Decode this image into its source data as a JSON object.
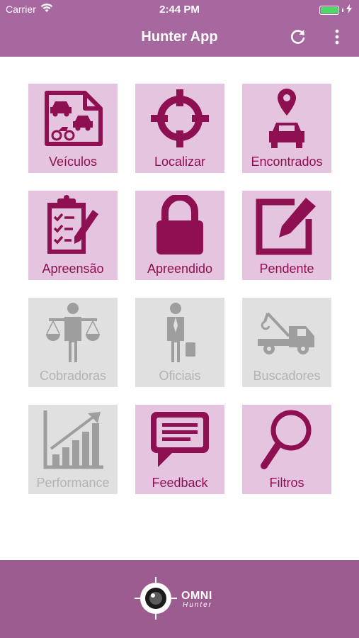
{
  "status_bar": {
    "carrier": "Carrier",
    "time": "2:44 PM",
    "battery_level": 1.0
  },
  "nav": {
    "title": "Hunter App",
    "refresh_icon": "refresh-icon",
    "menu_icon": "more-vertical-icon"
  },
  "colors": {
    "bar": "#a6689f",
    "footer": "#9c5c8f",
    "tile_active": "#e5c4df",
    "tile_disabled": "#e0e0e0",
    "icon_active": "#8e0f52",
    "icon_disabled": "#9e9e9e"
  },
  "tiles": [
    {
      "label": "Veículos",
      "icon": "vehicles-document-icon",
      "enabled": true
    },
    {
      "label": "Localizar",
      "icon": "crosshair-icon",
      "enabled": true
    },
    {
      "label": "Encontrados",
      "icon": "car-location-pin-icon",
      "enabled": true
    },
    {
      "label": "Apreensão",
      "icon": "clipboard-checklist-icon",
      "enabled": true
    },
    {
      "label": "Apreendido",
      "icon": "padlock-icon",
      "enabled": true
    },
    {
      "label": "Pendente",
      "icon": "edit-square-icon",
      "enabled": true
    },
    {
      "label": "Cobradoras",
      "icon": "person-scales-icon",
      "enabled": false
    },
    {
      "label": "Oficiais",
      "icon": "person-briefcase-icon",
      "enabled": false
    },
    {
      "label": "Buscadores",
      "icon": "tow-truck-icon",
      "enabled": false
    },
    {
      "label": "Performance",
      "icon": "growth-chart-icon",
      "enabled": false
    },
    {
      "label": "Feedback",
      "icon": "chat-bubble-icon",
      "enabled": true
    },
    {
      "label": "Filtros",
      "icon": "magnifier-icon",
      "enabled": true
    }
  ],
  "footer": {
    "logo_main": "OMNI",
    "logo_sub": "Hunter",
    "logo_icon": "eye-target-icon"
  }
}
